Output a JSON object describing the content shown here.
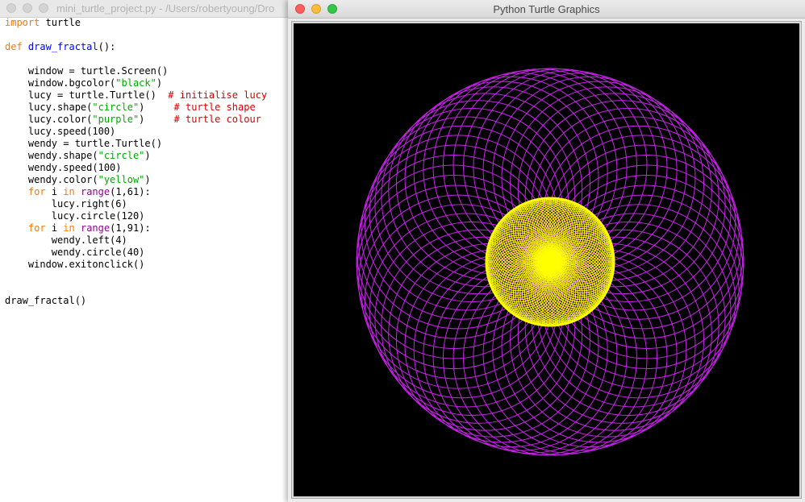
{
  "editor": {
    "title": "mini_turtle_project.py - /Users/robertyoung/Dro",
    "code_lines": [
      [
        {
          "t": "import",
          "c": "kw"
        },
        {
          "t": " turtle"
        }
      ],
      [],
      [
        {
          "t": "def",
          "c": "kw"
        },
        {
          "t": " "
        },
        {
          "t": "draw_fractal",
          "c": "fn"
        },
        {
          "t": "():"
        }
      ],
      [],
      [
        {
          "t": "    window = turtle.Screen()"
        }
      ],
      [
        {
          "t": "    window.bgcolor("
        },
        {
          "t": "\"black\"",
          "c": "str"
        },
        {
          "t": ")"
        }
      ],
      [
        {
          "t": "    lucy = turtle.Turtle()  "
        },
        {
          "t": "# initialise lucy",
          "c": "cm"
        }
      ],
      [
        {
          "t": "    lucy.shape("
        },
        {
          "t": "\"circle\"",
          "c": "str"
        },
        {
          "t": ")     "
        },
        {
          "t": "# turtle shape",
          "c": "cm"
        }
      ],
      [
        {
          "t": "    lucy.color("
        },
        {
          "t": "\"purple\"",
          "c": "str"
        },
        {
          "t": ")     "
        },
        {
          "t": "# turtle colour",
          "c": "cm"
        }
      ],
      [
        {
          "t": "    lucy.speed(100)"
        }
      ],
      [
        {
          "t": "    wendy = turtle.Turtle()"
        }
      ],
      [
        {
          "t": "    wendy.shape("
        },
        {
          "t": "\"circle\"",
          "c": "str"
        },
        {
          "t": ")"
        }
      ],
      [
        {
          "t": "    wendy.speed(100)"
        }
      ],
      [
        {
          "t": "    wendy.color("
        },
        {
          "t": "\"yellow\"",
          "c": "str"
        },
        {
          "t": ")"
        }
      ],
      [
        {
          "t": "    "
        },
        {
          "t": "for",
          "c": "kw"
        },
        {
          "t": " i "
        },
        {
          "t": "in",
          "c": "kw"
        },
        {
          "t": " "
        },
        {
          "t": "range",
          "c": "bi"
        },
        {
          "t": "(1,61):"
        }
      ],
      [
        {
          "t": "        lucy.right(6)"
        }
      ],
      [
        {
          "t": "        lucy.circle(120)"
        }
      ],
      [
        {
          "t": "    "
        },
        {
          "t": "for",
          "c": "kw"
        },
        {
          "t": " i "
        },
        {
          "t": "in",
          "c": "kw"
        },
        {
          "t": " "
        },
        {
          "t": "range",
          "c": "bi"
        },
        {
          "t": "(1,91):"
        }
      ],
      [
        {
          "t": "        wendy.left(4)"
        }
      ],
      [
        {
          "t": "        wendy.circle(40)"
        }
      ],
      [
        {
          "t": "    window.exitonclick()"
        }
      ],
      [],
      [],
      [
        {
          "t": "draw_fractal()"
        }
      ]
    ]
  },
  "turtle_window": {
    "title": "Python Turtle Graphics",
    "drawing": {
      "background": "#000000",
      "purple_pattern": {
        "color": "#cc22ee",
        "circle_count": 60,
        "step_degrees": 6,
        "radius": 120
      },
      "yellow_pattern": {
        "color": "#ffff00",
        "circle_count": 90,
        "step_degrees": 4,
        "radius": 40
      }
    }
  }
}
